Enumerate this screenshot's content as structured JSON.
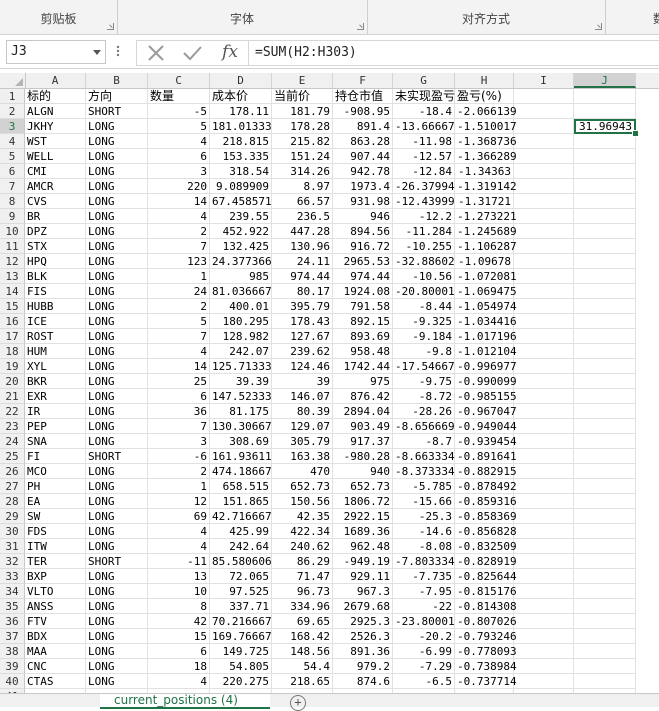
{
  "ribbon": {
    "groups": [
      {
        "label": "剪贴板"
      },
      {
        "label": "字体"
      },
      {
        "label": "对齐方式"
      },
      {
        "label": "数"
      }
    ]
  },
  "formula_bar": {
    "name_box": "J3",
    "formula": "=SUM(H2:H303)",
    "fx_label": "fx"
  },
  "columns": [
    "A",
    "B",
    "C",
    "D",
    "E",
    "F",
    "G",
    "H",
    "I",
    "J"
  ],
  "header_row": [
    "标的",
    "方向",
    "数量",
    "成本价",
    "当前价",
    "持仓市值",
    "未实现盈亏",
    "盈亏(%)"
  ],
  "rows": [
    [
      "ALGN",
      "SHORT",
      "-5",
      "178.11",
      "181.79",
      "-908.95",
      "-18.4",
      "-2.066139"
    ],
    [
      "JKHY",
      "LONG",
      "5",
      "181.01333",
      "178.28",
      "891.4",
      "-13.66667",
      "-1.510017"
    ],
    [
      "WST",
      "LONG",
      "4",
      "218.815",
      "215.82",
      "863.28",
      "-11.98",
      "-1.368736"
    ],
    [
      "WELL",
      "LONG",
      "6",
      "153.335",
      "151.24",
      "907.44",
      "-12.57",
      "-1.366289"
    ],
    [
      "CMI",
      "LONG",
      "3",
      "318.54",
      "314.26",
      "942.78",
      "-12.84",
      "-1.34363"
    ],
    [
      "AMCR",
      "LONG",
      "220",
      "9.089909",
      "8.97",
      "1973.4",
      "-26.37994",
      "-1.319142"
    ],
    [
      "CVS",
      "LONG",
      "14",
      "67.458571",
      "66.57",
      "931.98",
      "-12.43999",
      "-1.31721"
    ],
    [
      "BR",
      "LONG",
      "4",
      "239.55",
      "236.5",
      "946",
      "-12.2",
      "-1.273221"
    ],
    [
      "DPZ",
      "LONG",
      "2",
      "452.922",
      "447.28",
      "894.56",
      "-11.284",
      "-1.245689"
    ],
    [
      "STX",
      "LONG",
      "7",
      "132.425",
      "130.96",
      "916.72",
      "-10.255",
      "-1.106287"
    ],
    [
      "HPQ",
      "LONG",
      "123",
      "24.377366",
      "24.11",
      "2965.53",
      "-32.88602",
      "-1.09678"
    ],
    [
      "BLK",
      "LONG",
      "1",
      "985",
      "974.44",
      "974.44",
      "-10.56",
      "-1.072081"
    ],
    [
      "FIS",
      "LONG",
      "24",
      "81.036667",
      "80.17",
      "1924.08",
      "-20.80001",
      "-1.069475"
    ],
    [
      "HUBB",
      "LONG",
      "2",
      "400.01",
      "395.79",
      "791.58",
      "-8.44",
      "-1.054974"
    ],
    [
      "ICE",
      "LONG",
      "5",
      "180.295",
      "178.43",
      "892.15",
      "-9.325",
      "-1.034416"
    ],
    [
      "ROST",
      "LONG",
      "7",
      "128.982",
      "127.67",
      "893.69",
      "-9.184",
      "-1.017196"
    ],
    [
      "HUM",
      "LONG",
      "4",
      "242.07",
      "239.62",
      "958.48",
      "-9.8",
      "-1.012104"
    ],
    [
      "XYL",
      "LONG",
      "14",
      "125.71333",
      "124.46",
      "1742.44",
      "-17.54667",
      "-0.996977"
    ],
    [
      "BKR",
      "LONG",
      "25",
      "39.39",
      "39",
      "975",
      "-9.75",
      "-0.990099"
    ],
    [
      "EXR",
      "LONG",
      "6",
      "147.52333",
      "146.07",
      "876.42",
      "-8.72",
      "-0.985155"
    ],
    [
      "IR",
      "LONG",
      "36",
      "81.175",
      "80.39",
      "2894.04",
      "-28.26",
      "-0.967047"
    ],
    [
      "PEP",
      "LONG",
      "7",
      "130.30667",
      "129.07",
      "903.49",
      "-8.656669",
      "-0.949044"
    ],
    [
      "SNA",
      "LONG",
      "3",
      "308.69",
      "305.79",
      "917.37",
      "-8.7",
      "-0.939454"
    ],
    [
      "FI",
      "SHORT",
      "-6",
      "161.93611",
      "163.38",
      "-980.28",
      "-8.663334",
      "-0.891641"
    ],
    [
      "MCO",
      "LONG",
      "2",
      "474.18667",
      "470",
      "940",
      "-8.373334",
      "-0.882915"
    ],
    [
      "PH",
      "LONG",
      "1",
      "658.515",
      "652.73",
      "652.73",
      "-5.785",
      "-0.878492"
    ],
    [
      "EA",
      "LONG",
      "12",
      "151.865",
      "150.56",
      "1806.72",
      "-15.66",
      "-0.859316"
    ],
    [
      "SW",
      "LONG",
      "69",
      "42.716667",
      "42.35",
      "2922.15",
      "-25.3",
      "-0.858369"
    ],
    [
      "FDS",
      "LONG",
      "4",
      "425.99",
      "422.34",
      "1689.36",
      "-14.6",
      "-0.856828"
    ],
    [
      "ITW",
      "LONG",
      "4",
      "242.64",
      "240.62",
      "962.48",
      "-8.08",
      "-0.832509"
    ],
    [
      "TER",
      "SHORT",
      "-11",
      "85.580606",
      "86.29",
      "-949.19",
      "-7.803334",
      "-0.828919"
    ],
    [
      "BXP",
      "LONG",
      "13",
      "72.065",
      "71.47",
      "929.11",
      "-7.735",
      "-0.825644"
    ],
    [
      "VLTO",
      "LONG",
      "10",
      "97.525",
      "96.73",
      "967.3",
      "-7.95",
      "-0.815176"
    ],
    [
      "ANSS",
      "LONG",
      "8",
      "337.71",
      "334.96",
      "2679.68",
      "-22",
      "-0.814308"
    ],
    [
      "FTV",
      "LONG",
      "42",
      "70.216667",
      "69.65",
      "2925.3",
      "-23.80001",
      "-0.807026"
    ],
    [
      "BDX",
      "LONG",
      "15",
      "169.76667",
      "168.42",
      "2526.3",
      "-20.2",
      "-0.793246"
    ],
    [
      "MAA",
      "LONG",
      "6",
      "149.725",
      "148.56",
      "891.36",
      "-6.99",
      "-0.778093"
    ],
    [
      "CNC",
      "LONG",
      "18",
      "54.805",
      "54.4",
      "979.2",
      "-7.29",
      "-0.738984"
    ],
    [
      "CTAS",
      "LONG",
      "4",
      "220.275",
      "218.65",
      "874.6",
      "-6.5",
      "-0.737714"
    ]
  ],
  "active_cell": {
    "ref": "J3",
    "value": "31.96943"
  },
  "sheet_tab": "current_positions (4)",
  "add_sheet_symbol": "+"
}
